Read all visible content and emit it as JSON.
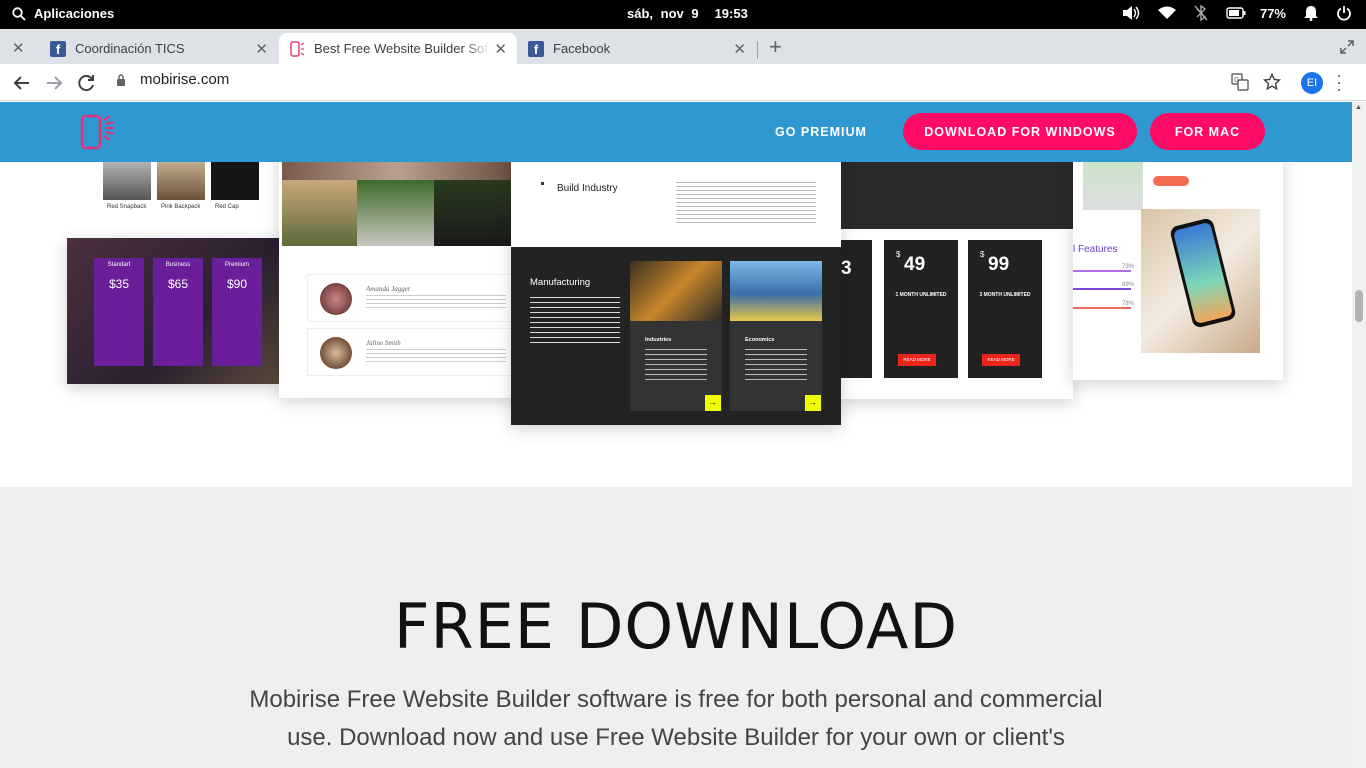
{
  "system_bar": {
    "apps_label": "Aplicaciones",
    "date": "sáb, nov  9",
    "time": "19:53",
    "battery": "77%"
  },
  "tabs": [
    {
      "title": "Coordinación TICS",
      "favicon": "facebook-icon"
    },
    {
      "title": "Best Free Website Builder Software",
      "favicon": "mobirise-icon",
      "active": true
    },
    {
      "title": "Facebook",
      "favicon": "facebook-icon"
    }
  ],
  "toolbar": {
    "url": "mobirise.com",
    "profile_initials": "EI"
  },
  "site_nav": {
    "premium_label": "GO PREMIUM",
    "download_windows_label": "DOWNLOAD FOR WINDOWS",
    "mac_label": "FOR MAC"
  },
  "showcase": {
    "shop_items": [
      "Red Snapback",
      "Pink Backpack",
      "Red Cap"
    ],
    "pricing_plans": [
      {
        "name": "Standart",
        "price": "$35"
      },
      {
        "name": "Business",
        "price": "$65"
      },
      {
        "name": "Premium",
        "price": "$90"
      }
    ],
    "testimonials": [
      "Amanda Jagger",
      "Jaline Smith"
    ],
    "industry_title": "Build Industry",
    "manufacturing_title": "Manufacturing",
    "industry_cards": [
      "Industries",
      "Economics"
    ],
    "gym_prices": [
      {
        "price": "49",
        "label": "1 MONTH UNLIMITED"
      },
      {
        "price": "99",
        "label": "3 MONTH UNLIMITED"
      }
    ],
    "gym_partial_price": "3",
    "gym_button": "READ MORE",
    "features_label": "l Features",
    "feature_percents": [
      "73%",
      "89%",
      "78%"
    ]
  },
  "free_download": {
    "title": "FREE DOWNLOAD",
    "body": "Mobirise Free Website Builder software is free for both personal and commercial use. Download now and use Free Website Builder for your own or client's"
  },
  "colors": {
    "nav_blue": "#2f98d0",
    "accent_pink": "#ff0a66",
    "section_gray": "#efefef"
  }
}
